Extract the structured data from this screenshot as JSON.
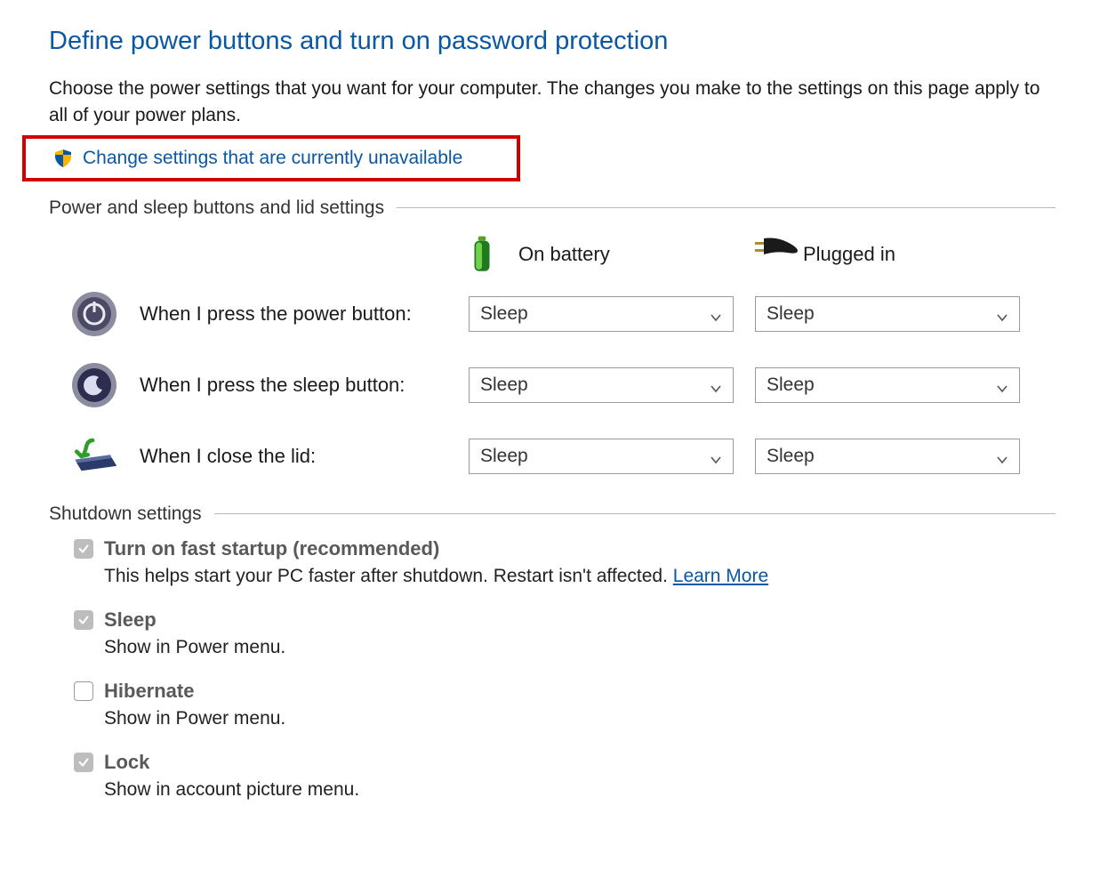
{
  "title": "Define power buttons and turn on password protection",
  "intro": "Choose the power settings that you want for your computer. The changes you make to the settings on this page apply to all of your power plans.",
  "change_link": "Change settings that are currently unavailable",
  "groups": {
    "power_header": "Power and sleep buttons and lid settings",
    "shutdown_header": "Shutdown settings"
  },
  "columns": {
    "battery": "On battery",
    "plugged": "Plugged in"
  },
  "rows": {
    "power_button": {
      "label": "When I press the power button:",
      "battery": "Sleep",
      "plugged": "Sleep"
    },
    "sleep_button": {
      "label": "When I press the sleep button:",
      "battery": "Sleep",
      "plugged": "Sleep"
    },
    "lid": {
      "label": "When I close the lid:",
      "battery": "Sleep",
      "plugged": "Sleep"
    }
  },
  "shutdown": {
    "fast_startup": {
      "title": "Turn on fast startup (recommended)",
      "desc": "This helps start your PC faster after shutdown. Restart isn't affected.",
      "learn_more": "Learn More",
      "checked": true
    },
    "sleep": {
      "title": "Sleep",
      "desc": "Show in Power menu.",
      "checked": true
    },
    "hibernate": {
      "title": "Hibernate",
      "desc": "Show in Power menu.",
      "checked": false
    },
    "lock": {
      "title": "Lock",
      "desc": "Show in account picture menu.",
      "checked": true
    }
  }
}
